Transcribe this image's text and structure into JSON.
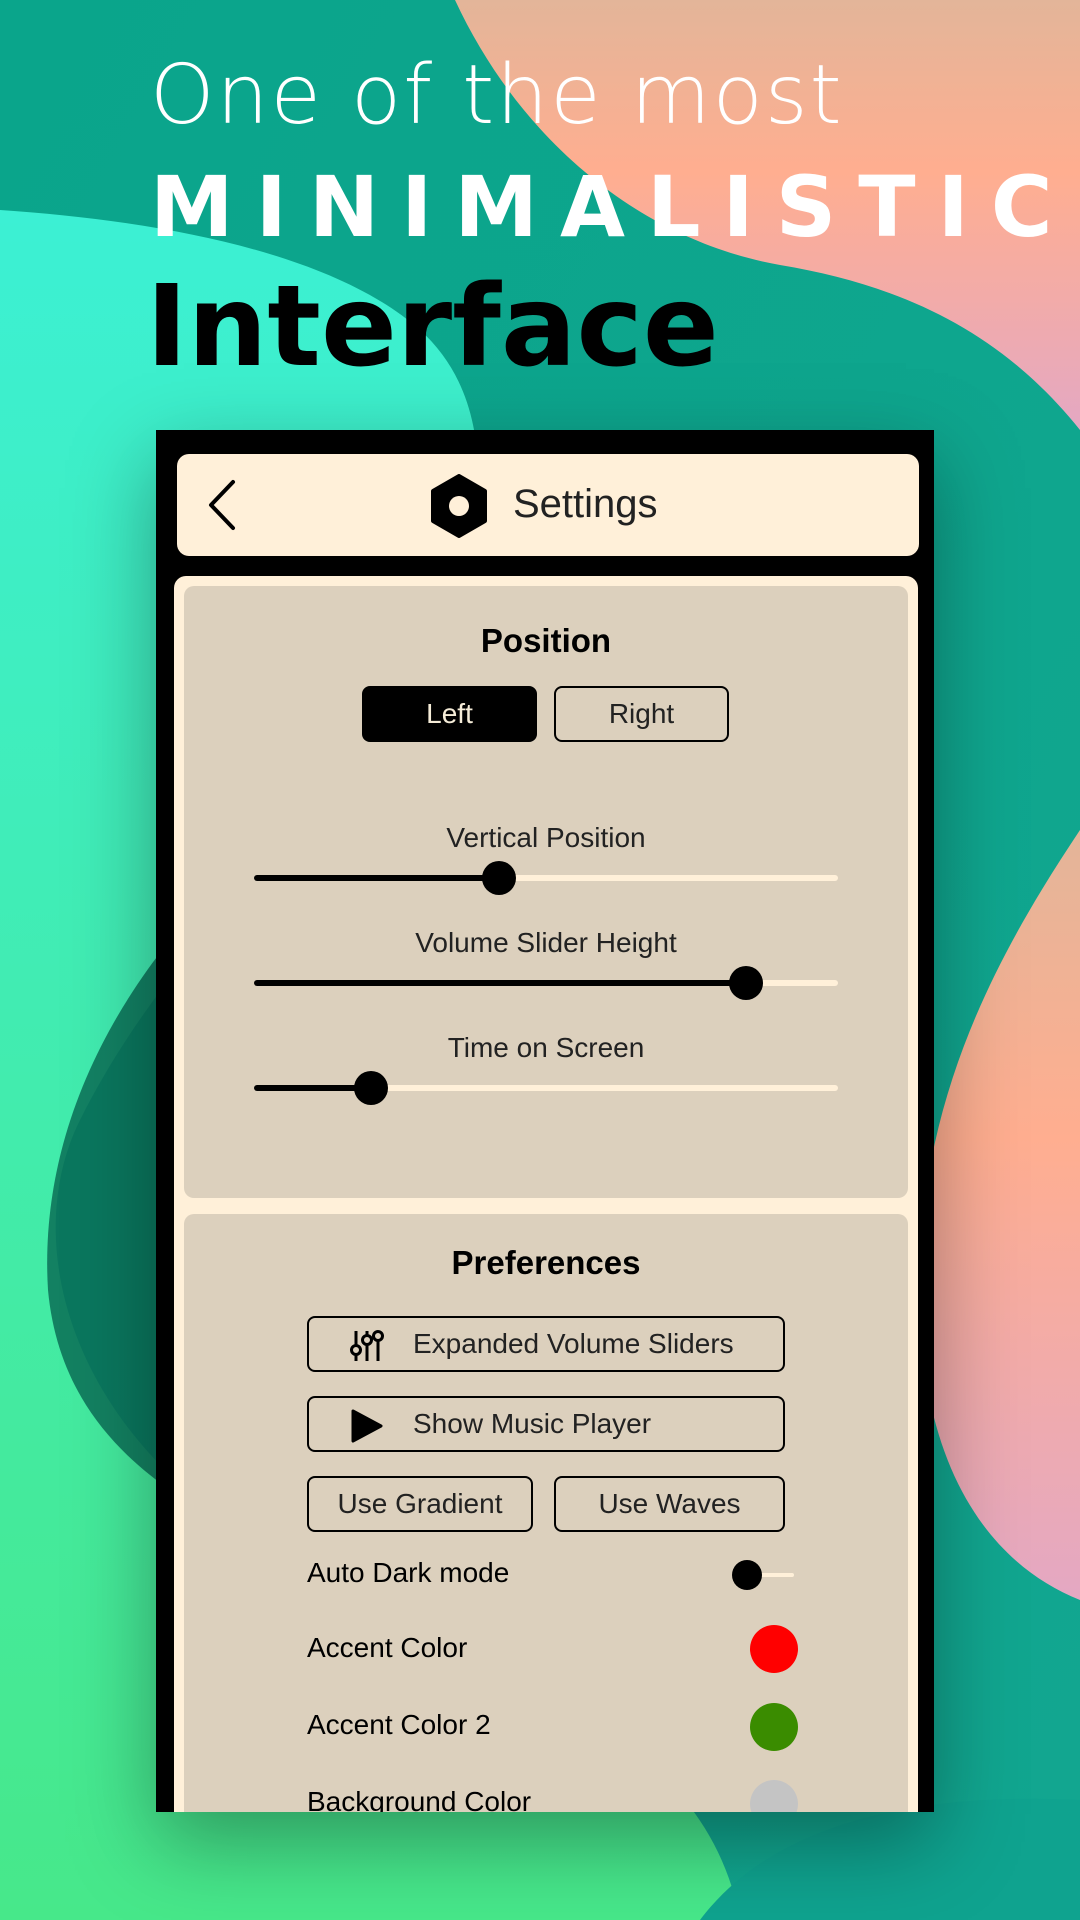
{
  "headline": {
    "line1": "One of the most",
    "line2": "MINIMALISTIC",
    "line3": "Interface"
  },
  "header": {
    "back_icon": "chevron-left-icon",
    "gear_icon": "gear-icon",
    "title": "Settings"
  },
  "position_section": {
    "title": "Position",
    "options": [
      {
        "label": "Left",
        "selected": true
      },
      {
        "label": "Right",
        "selected": false
      }
    ],
    "sliders": [
      {
        "label": "Vertical Position",
        "value": 0.42
      },
      {
        "label": "Volume Slider Height",
        "value": 0.843
      },
      {
        "label": "Time on Screen",
        "value": 0.2
      }
    ]
  },
  "preferences_section": {
    "title": "Preferences",
    "expanded_sliders": {
      "label": "Expanded Volume Sliders",
      "icon": "sliders-icon"
    },
    "music_player": {
      "label": "Show Music Player",
      "icon": "play-icon"
    },
    "gradient": {
      "label": "Use Gradient"
    },
    "waves": {
      "label": "Use Waves"
    },
    "auto_dark": {
      "label": "Auto Dark mode",
      "on": false
    },
    "accent_color": {
      "label": "Accent Color",
      "color": "#ff0000"
    },
    "accent_color_2": {
      "label": "Accent Color 2",
      "color": "#3a8c00"
    },
    "background_color": {
      "label": "Background Color",
      "color": "#c4c4c4"
    }
  },
  "colors": {
    "panel_cream": "#fff0d9",
    "card_beige": "#dcd0bd",
    "teal": "#0fae8d",
    "peach": "#ffb093",
    "mint": "#3de9c9"
  }
}
